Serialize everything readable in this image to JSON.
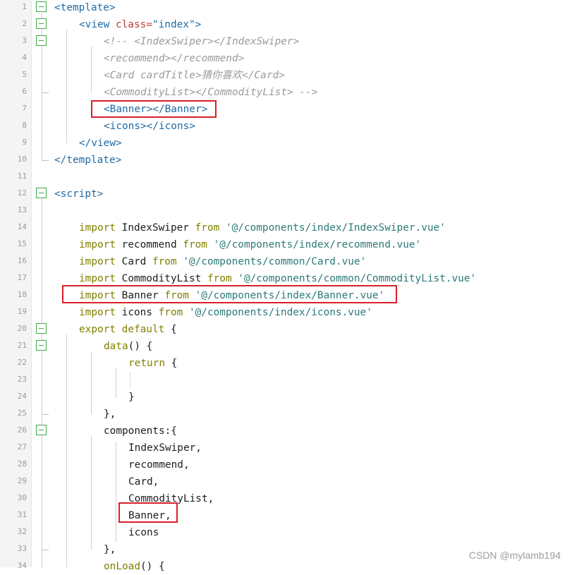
{
  "watermark": "CSDN @mylamb194",
  "lines": [
    {
      "n": "1",
      "fold": true,
      "tokens": [
        {
          "t": "<template>",
          "c": "tag"
        }
      ]
    },
    {
      "n": "2",
      "fold": true,
      "tokens": [
        {
          "t": "<view ",
          "c": "tag"
        },
        {
          "t": "class=",
          "c": "attr"
        },
        {
          "t": "\"index\"",
          "c": "tag"
        },
        {
          "t": ">",
          "c": "tag"
        }
      ]
    },
    {
      "n": "3",
      "fold": true,
      "tokens": [
        {
          "t": "<!-- <IndexSwiper></IndexSwiper>",
          "c": "cmt"
        }
      ]
    },
    {
      "n": "4",
      "fold": false,
      "tokens": [
        {
          "t": "<recommend></recommend>",
          "c": "cmt"
        }
      ]
    },
    {
      "n": "5",
      "fold": false,
      "tokens": [
        {
          "t": "<Card cardTitle>猜你喜欢</Card>",
          "c": "cmt"
        }
      ]
    },
    {
      "n": "6",
      "fold": false,
      "tokens": [
        {
          "t": "<CommodityList></CommodityList> -->",
          "c": "cmt"
        }
      ]
    },
    {
      "n": "7",
      "fold": false,
      "tokens": [
        {
          "t": "<Banner></Banner>",
          "c": "tag"
        }
      ]
    },
    {
      "n": "8",
      "fold": false,
      "tokens": [
        {
          "t": "<icons></icons>",
          "c": "tag"
        }
      ]
    },
    {
      "n": "9",
      "fold": false,
      "tokens": [
        {
          "t": "</view>",
          "c": "tag"
        }
      ]
    },
    {
      "n": "10",
      "fold": false,
      "tokens": [
        {
          "t": "</template>",
          "c": "tag"
        }
      ]
    },
    {
      "n": "11",
      "fold": false,
      "tokens": []
    },
    {
      "n": "12",
      "fold": true,
      "tokens": [
        {
          "t": "<script>",
          "c": "tag"
        }
      ]
    },
    {
      "n": "13",
      "fold": false,
      "tokens": []
    },
    {
      "n": "14",
      "fold": false,
      "tokens": [
        {
          "t": "import ",
          "c": "kw"
        },
        {
          "t": "IndexSwiper ",
          "c": "pl"
        },
        {
          "t": "from ",
          "c": "kw"
        },
        {
          "t": "'@/components/index/IndexSwiper.vue'",
          "c": "str"
        }
      ]
    },
    {
      "n": "15",
      "fold": false,
      "tokens": [
        {
          "t": "import ",
          "c": "kw"
        },
        {
          "t": "recommend ",
          "c": "pl"
        },
        {
          "t": "from ",
          "c": "kw"
        },
        {
          "t": "'@/components/index/recommend.vue'",
          "c": "str"
        }
      ]
    },
    {
      "n": "16",
      "fold": false,
      "tokens": [
        {
          "t": "import ",
          "c": "kw"
        },
        {
          "t": "Card ",
          "c": "pl"
        },
        {
          "t": "from ",
          "c": "kw"
        },
        {
          "t": "'@/components/common/Card.vue'",
          "c": "str"
        }
      ]
    },
    {
      "n": "17",
      "fold": false,
      "tokens": [
        {
          "t": "import ",
          "c": "kw"
        },
        {
          "t": "CommodityList ",
          "c": "pl"
        },
        {
          "t": "from ",
          "c": "kw"
        },
        {
          "t": "'@/components/common/CommodityList.vue'",
          "c": "str"
        }
      ]
    },
    {
      "n": "18",
      "fold": false,
      "tokens": [
        {
          "t": "import ",
          "c": "kw"
        },
        {
          "t": "Banner ",
          "c": "pl"
        },
        {
          "t": "from ",
          "c": "kw"
        },
        {
          "t": "'@/components/index/Banner.vue'",
          "c": "str"
        }
      ]
    },
    {
      "n": "19",
      "fold": false,
      "tokens": [
        {
          "t": "import ",
          "c": "kw"
        },
        {
          "t": "icons ",
          "c": "pl"
        },
        {
          "t": "from ",
          "c": "kw"
        },
        {
          "t": "'@/components/index/icons.vue'",
          "c": "str"
        }
      ]
    },
    {
      "n": "20",
      "fold": true,
      "tokens": [
        {
          "t": "export ",
          "c": "kw"
        },
        {
          "t": "default ",
          "c": "kw"
        },
        {
          "t": "{",
          "c": "pl"
        }
      ]
    },
    {
      "n": "21",
      "fold": true,
      "tokens": [
        {
          "t": "data",
          "c": "fn"
        },
        {
          "t": "() {",
          "c": "pl"
        }
      ]
    },
    {
      "n": "22",
      "fold": false,
      "tokens": [
        {
          "t": "return ",
          "c": "kw"
        },
        {
          "t": "{",
          "c": "pl"
        }
      ]
    },
    {
      "n": "23",
      "fold": false,
      "tokens": []
    },
    {
      "n": "24",
      "fold": false,
      "tokens": [
        {
          "t": "}",
          "c": "pl"
        }
      ]
    },
    {
      "n": "25",
      "fold": false,
      "tokens": [
        {
          "t": "},",
          "c": "pl"
        }
      ]
    },
    {
      "n": "26",
      "fold": true,
      "tokens": [
        {
          "t": "components:{",
          "c": "pl"
        }
      ]
    },
    {
      "n": "27",
      "fold": false,
      "tokens": [
        {
          "t": "IndexSwiper,",
          "c": "pl"
        }
      ]
    },
    {
      "n": "28",
      "fold": false,
      "tokens": [
        {
          "t": "recommend,",
          "c": "pl"
        }
      ]
    },
    {
      "n": "29",
      "fold": false,
      "tokens": [
        {
          "t": "Card,",
          "c": "pl"
        }
      ]
    },
    {
      "n": "30",
      "fold": false,
      "tokens": [
        {
          "t": "CommodityList,",
          "c": "pl"
        }
      ]
    },
    {
      "n": "31",
      "fold": false,
      "tokens": [
        {
          "t": "Banner,",
          "c": "pl"
        }
      ]
    },
    {
      "n": "32",
      "fold": false,
      "tokens": [
        {
          "t": "icons",
          "c": "pl"
        }
      ]
    },
    {
      "n": "33",
      "fold": false,
      "tokens": [
        {
          "t": "},",
          "c": "pl"
        }
      ]
    },
    {
      "n": "34",
      "fold": false,
      "tokens": [
        {
          "t": "onLoad",
          "c": "fn"
        },
        {
          "t": "() {",
          "c": "pl"
        }
      ]
    }
  ]
}
